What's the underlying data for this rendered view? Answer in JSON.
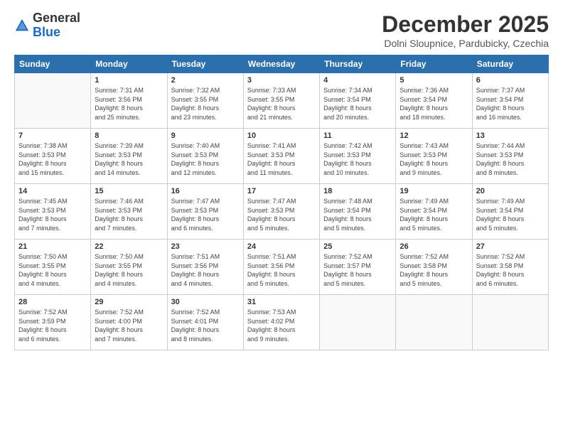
{
  "logo": {
    "general": "General",
    "blue": "Blue"
  },
  "title": "December 2025",
  "location": "Dolni Sloupnice, Pardubicky, Czechia",
  "header": {
    "days": [
      "Sunday",
      "Monday",
      "Tuesday",
      "Wednesday",
      "Thursday",
      "Friday",
      "Saturday"
    ]
  },
  "weeks": [
    [
      {
        "day": "",
        "info": ""
      },
      {
        "day": "1",
        "info": "Sunrise: 7:31 AM\nSunset: 3:56 PM\nDaylight: 8 hours\nand 25 minutes."
      },
      {
        "day": "2",
        "info": "Sunrise: 7:32 AM\nSunset: 3:55 PM\nDaylight: 8 hours\nand 23 minutes."
      },
      {
        "day": "3",
        "info": "Sunrise: 7:33 AM\nSunset: 3:55 PM\nDaylight: 8 hours\nand 21 minutes."
      },
      {
        "day": "4",
        "info": "Sunrise: 7:34 AM\nSunset: 3:54 PM\nDaylight: 8 hours\nand 20 minutes."
      },
      {
        "day": "5",
        "info": "Sunrise: 7:36 AM\nSunset: 3:54 PM\nDaylight: 8 hours\nand 18 minutes."
      },
      {
        "day": "6",
        "info": "Sunrise: 7:37 AM\nSunset: 3:54 PM\nDaylight: 8 hours\nand 16 minutes."
      }
    ],
    [
      {
        "day": "7",
        "info": "Sunrise: 7:38 AM\nSunset: 3:53 PM\nDaylight: 8 hours\nand 15 minutes."
      },
      {
        "day": "8",
        "info": "Sunrise: 7:39 AM\nSunset: 3:53 PM\nDaylight: 8 hours\nand 14 minutes."
      },
      {
        "day": "9",
        "info": "Sunrise: 7:40 AM\nSunset: 3:53 PM\nDaylight: 8 hours\nand 12 minutes."
      },
      {
        "day": "10",
        "info": "Sunrise: 7:41 AM\nSunset: 3:53 PM\nDaylight: 8 hours\nand 11 minutes."
      },
      {
        "day": "11",
        "info": "Sunrise: 7:42 AM\nSunset: 3:53 PM\nDaylight: 8 hours\nand 10 minutes."
      },
      {
        "day": "12",
        "info": "Sunrise: 7:43 AM\nSunset: 3:53 PM\nDaylight: 8 hours\nand 9 minutes."
      },
      {
        "day": "13",
        "info": "Sunrise: 7:44 AM\nSunset: 3:53 PM\nDaylight: 8 hours\nand 8 minutes."
      }
    ],
    [
      {
        "day": "14",
        "info": "Sunrise: 7:45 AM\nSunset: 3:53 PM\nDaylight: 8 hours\nand 7 minutes."
      },
      {
        "day": "15",
        "info": "Sunrise: 7:46 AM\nSunset: 3:53 PM\nDaylight: 8 hours\nand 7 minutes."
      },
      {
        "day": "16",
        "info": "Sunrise: 7:47 AM\nSunset: 3:53 PM\nDaylight: 8 hours\nand 6 minutes."
      },
      {
        "day": "17",
        "info": "Sunrise: 7:47 AM\nSunset: 3:53 PM\nDaylight: 8 hours\nand 5 minutes."
      },
      {
        "day": "18",
        "info": "Sunrise: 7:48 AM\nSunset: 3:54 PM\nDaylight: 8 hours\nand 5 minutes."
      },
      {
        "day": "19",
        "info": "Sunrise: 7:49 AM\nSunset: 3:54 PM\nDaylight: 8 hours\nand 5 minutes."
      },
      {
        "day": "20",
        "info": "Sunrise: 7:49 AM\nSunset: 3:54 PM\nDaylight: 8 hours\nand 5 minutes."
      }
    ],
    [
      {
        "day": "21",
        "info": "Sunrise: 7:50 AM\nSunset: 3:55 PM\nDaylight: 8 hours\nand 4 minutes."
      },
      {
        "day": "22",
        "info": "Sunrise: 7:50 AM\nSunset: 3:55 PM\nDaylight: 8 hours\nand 4 minutes."
      },
      {
        "day": "23",
        "info": "Sunrise: 7:51 AM\nSunset: 3:56 PM\nDaylight: 8 hours\nand 4 minutes."
      },
      {
        "day": "24",
        "info": "Sunrise: 7:51 AM\nSunset: 3:56 PM\nDaylight: 8 hours\nand 5 minutes."
      },
      {
        "day": "25",
        "info": "Sunrise: 7:52 AM\nSunset: 3:57 PM\nDaylight: 8 hours\nand 5 minutes."
      },
      {
        "day": "26",
        "info": "Sunrise: 7:52 AM\nSunset: 3:58 PM\nDaylight: 8 hours\nand 5 minutes."
      },
      {
        "day": "27",
        "info": "Sunrise: 7:52 AM\nSunset: 3:58 PM\nDaylight: 8 hours\nand 6 minutes."
      }
    ],
    [
      {
        "day": "28",
        "info": "Sunrise: 7:52 AM\nSunset: 3:59 PM\nDaylight: 8 hours\nand 6 minutes."
      },
      {
        "day": "29",
        "info": "Sunrise: 7:52 AM\nSunset: 4:00 PM\nDaylight: 8 hours\nand 7 minutes."
      },
      {
        "day": "30",
        "info": "Sunrise: 7:52 AM\nSunset: 4:01 PM\nDaylight: 8 hours\nand 8 minutes."
      },
      {
        "day": "31",
        "info": "Sunrise: 7:53 AM\nSunset: 4:02 PM\nDaylight: 8 hours\nand 9 minutes."
      },
      {
        "day": "",
        "info": ""
      },
      {
        "day": "",
        "info": ""
      },
      {
        "day": "",
        "info": ""
      }
    ]
  ]
}
